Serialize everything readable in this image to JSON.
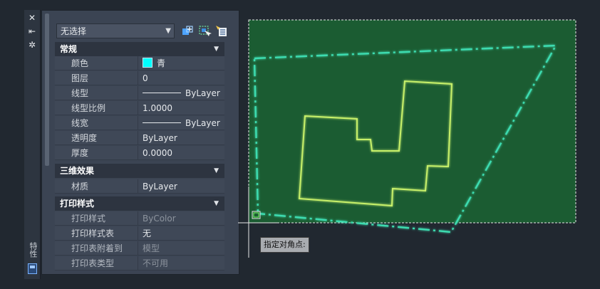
{
  "strip": {
    "close_glyph": "✕",
    "pin_glyph": "⇤",
    "settings_glyph": "✲",
    "title": "特性"
  },
  "palette": {
    "selection": "无选择",
    "sections": {
      "general": {
        "title": "常规",
        "rows": [
          {
            "label": "颜色",
            "value": "青"
          },
          {
            "label": "图层",
            "value": "0"
          },
          {
            "label": "线型",
            "value": "ByLayer"
          },
          {
            "label": "线型比例",
            "value": "1.0000"
          },
          {
            "label": "线宽",
            "value": "ByLayer"
          },
          {
            "label": "透明度",
            "value": "ByLayer"
          },
          {
            "label": "厚度",
            "value": "0.0000"
          }
        ]
      },
      "3d": {
        "title": "三维效果",
        "rows": [
          {
            "label": "材质",
            "value": "ByLayer"
          }
        ]
      },
      "plot": {
        "title": "打印样式",
        "rows": [
          {
            "label": "打印样式",
            "value": "ByColor"
          },
          {
            "label": "打印样式表",
            "value": "无"
          },
          {
            "label": "打印表附着到",
            "value": "模型"
          },
          {
            "label": "打印表类型",
            "value": "不可用"
          }
        ]
      }
    }
  },
  "canvas": {
    "tooltip": "指定对角点:",
    "colors": {
      "background": "#212830",
      "selection_fill": "#1b5c32",
      "boundary": "#3ddcb0",
      "building": "#c7f06a"
    }
  }
}
